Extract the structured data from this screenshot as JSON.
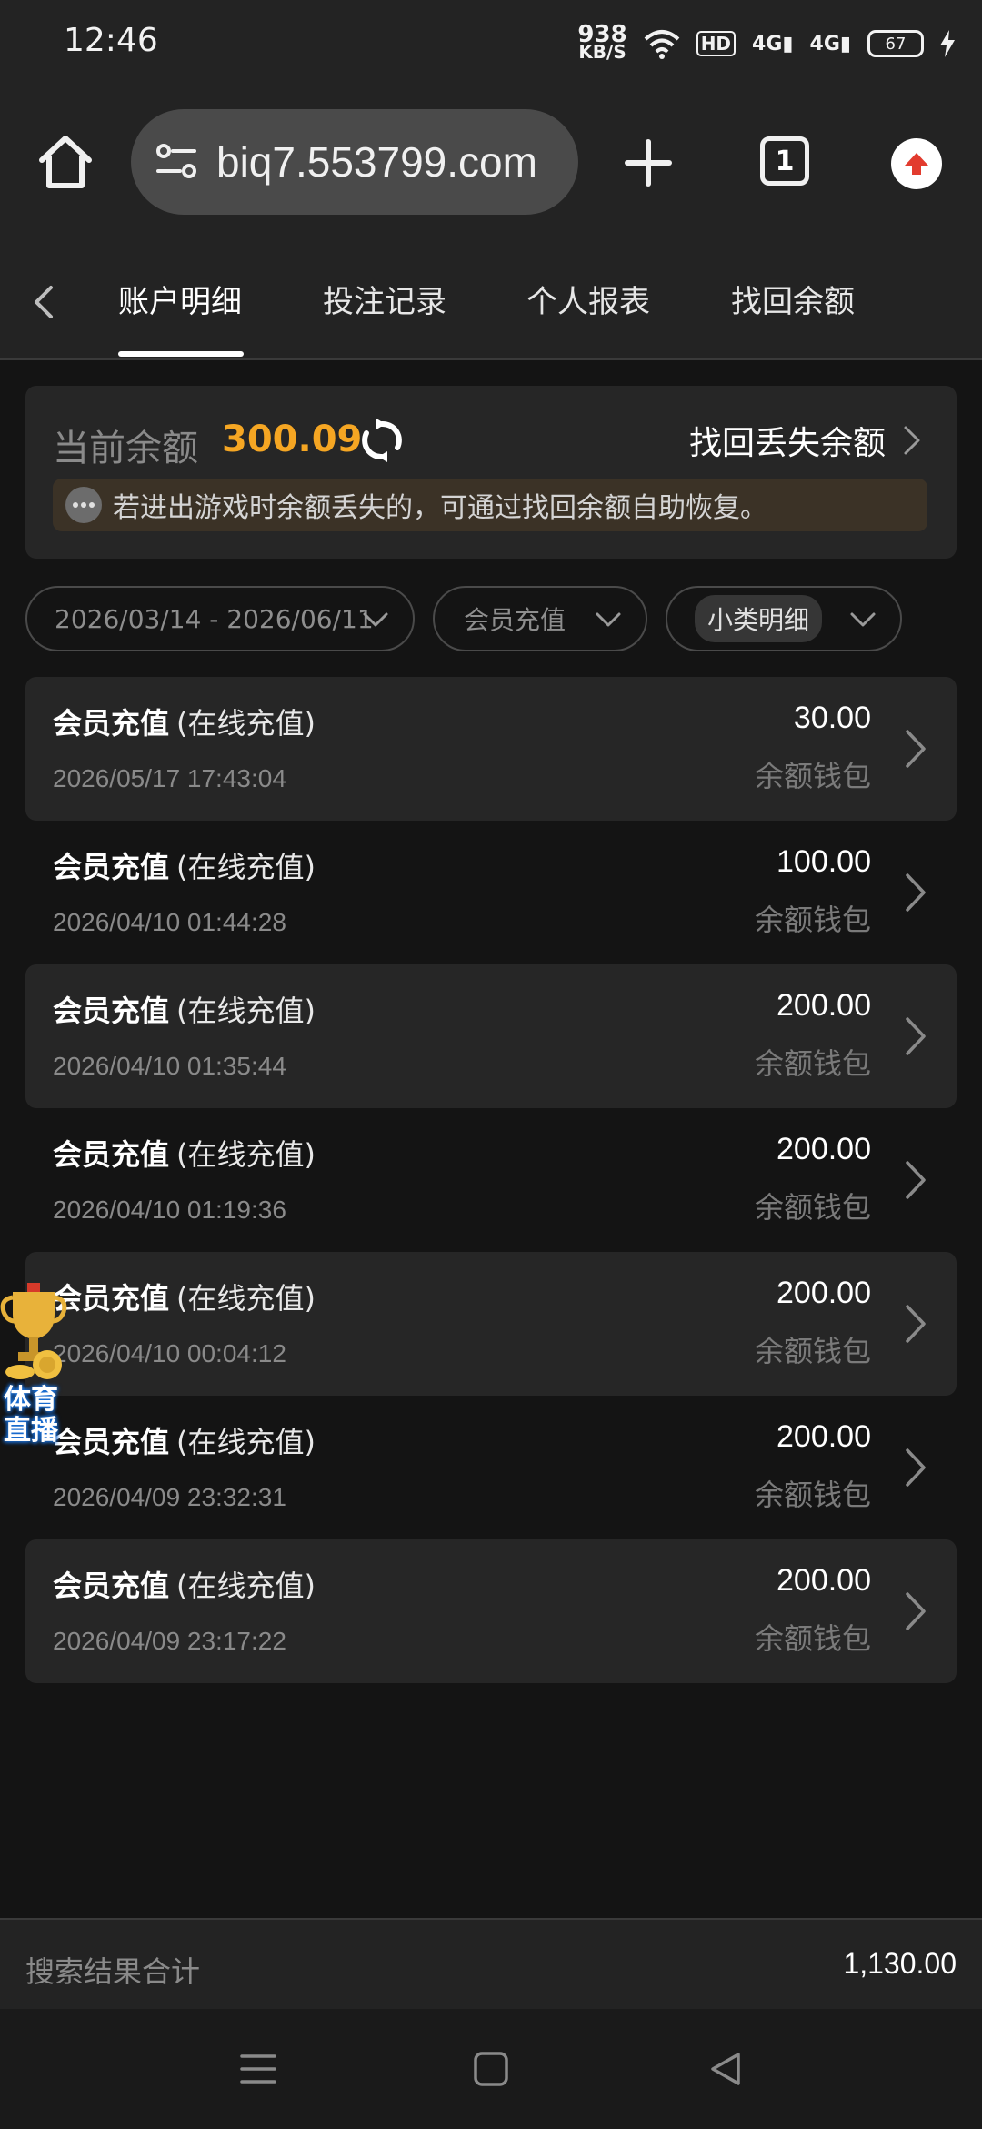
{
  "status_bar": {
    "time": "12:46",
    "net_speed_value": "938",
    "net_speed_unit": "KB/S",
    "hd_label": "HD",
    "signal1": "4G",
    "signal2": "4G",
    "battery": "67"
  },
  "browser": {
    "url": "biq7.553799.com",
    "tab_count": "1"
  },
  "tabs": [
    {
      "label": "账户明细",
      "active": true
    },
    {
      "label": "投注记录",
      "active": false
    },
    {
      "label": "个人报表",
      "active": false
    },
    {
      "label": "找回余额",
      "active": false
    }
  ],
  "balance": {
    "label": "当前余额",
    "value": "300.09",
    "recover_link": "找回丢失余额",
    "notice": "若进出游戏时余额丢失的，可通过找回余额自助恢复。"
  },
  "filters": {
    "date_range": "2026/03/14 - 2026/06/11",
    "type": "会员充值",
    "sub_type": "小类明细"
  },
  "records": [
    {
      "title": "会员充值",
      "sub": "(在线充值)",
      "time": "2026/05/17 17:43:04",
      "amount": "30.00",
      "wallet": "余额钱包"
    },
    {
      "title": "会员充值",
      "sub": "(在线充值)",
      "time": "2026/04/10 01:44:28",
      "amount": "100.00",
      "wallet": "余额钱包"
    },
    {
      "title": "会员充值",
      "sub": "(在线充值)",
      "time": "2026/04/10 01:35:44",
      "amount": "200.00",
      "wallet": "余额钱包"
    },
    {
      "title": "会员充值",
      "sub": "(在线充值)",
      "time": "2026/04/10 01:19:36",
      "amount": "200.00",
      "wallet": "余额钱包"
    },
    {
      "title": "会员充值",
      "sub": "(在线充值)",
      "time": "2026/04/10 00:04:12",
      "amount": "200.00",
      "wallet": "余额钱包"
    },
    {
      "title": "会员充值",
      "sub": "(在线充值)",
      "time": "2026/04/09 23:32:31",
      "amount": "200.00",
      "wallet": "余额钱包"
    },
    {
      "title": "会员充值",
      "sub": "(在线充值)",
      "time": "2026/04/09 23:17:22",
      "amount": "200.00",
      "wallet": "余额钱包"
    }
  ],
  "floating_badge": {
    "line1": "体育",
    "line2": "直播"
  },
  "total": {
    "label": "搜索结果合计",
    "value": "1,130.00"
  },
  "colors": {
    "accent": "#f5a623",
    "background": "#141414",
    "card": "#262626"
  }
}
